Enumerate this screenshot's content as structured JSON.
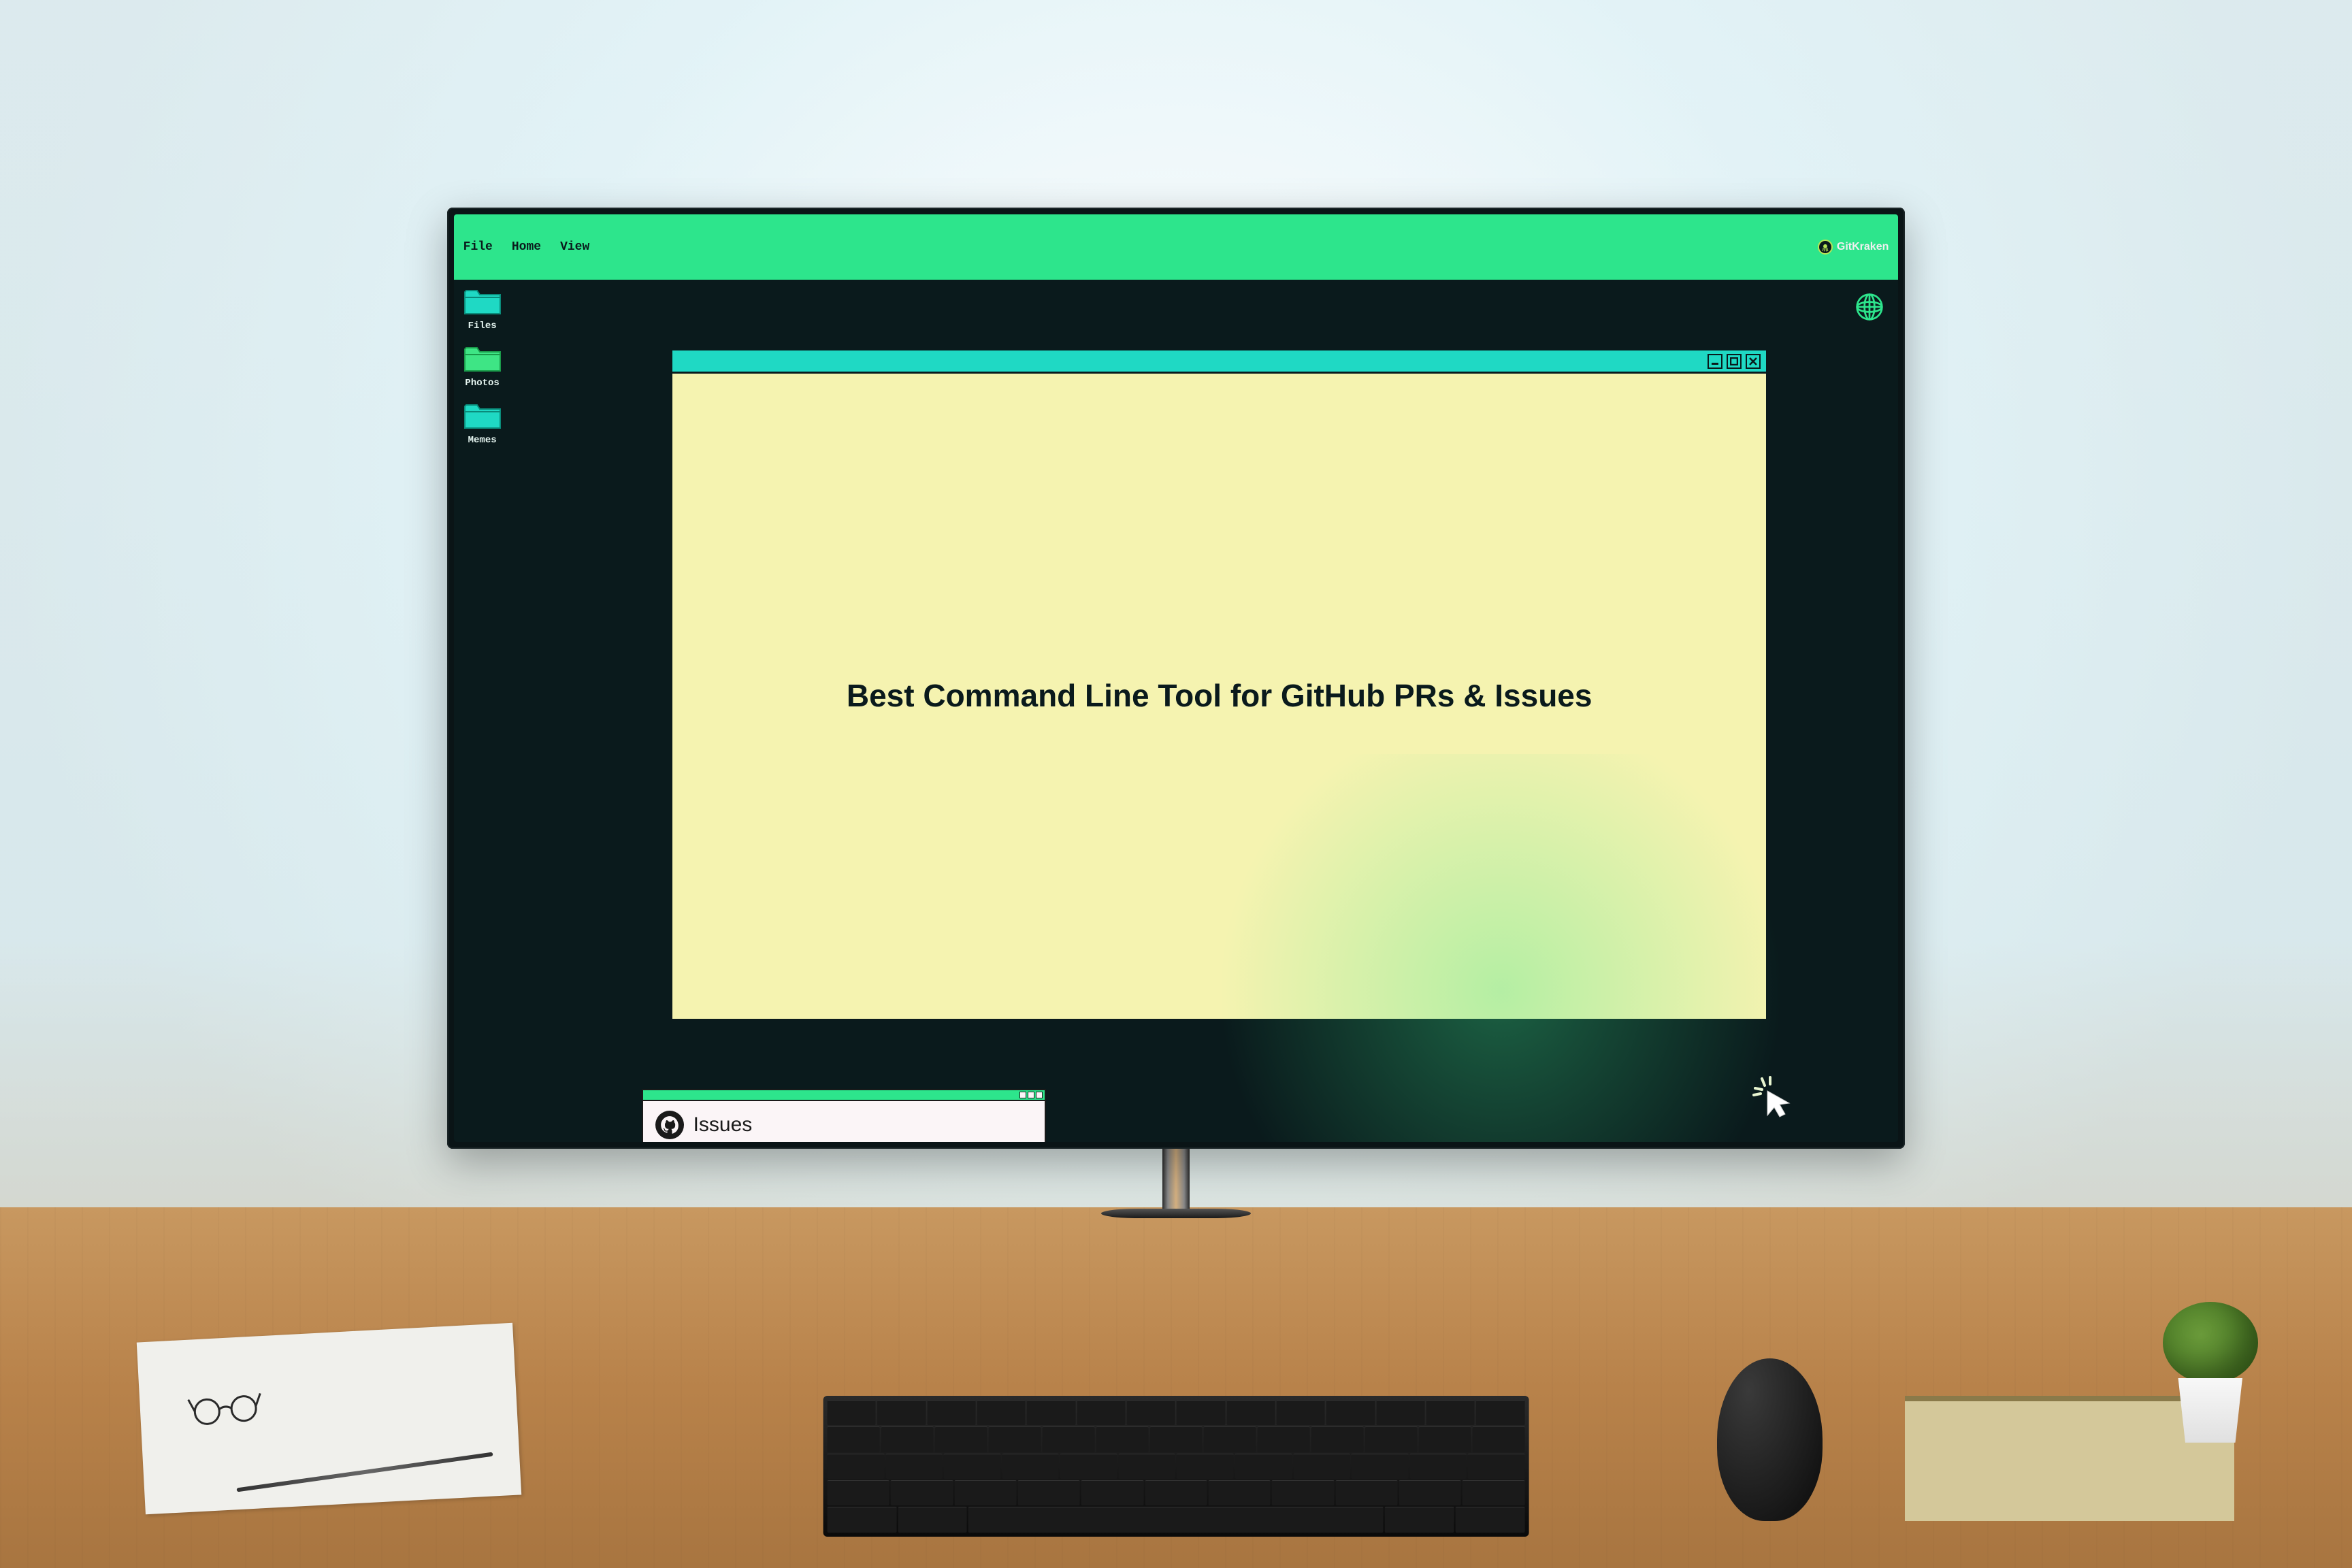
{
  "menubar": {
    "items": [
      "File",
      "Home",
      "View"
    ],
    "brand": "GitKraken"
  },
  "folders": [
    {
      "label": "Files",
      "color": "#1fd9c4"
    },
    {
      "label": "Photos",
      "color": "#3ee585"
    },
    {
      "label": "Memes",
      "color": "#1fd9c4"
    }
  ],
  "main_window": {
    "headline": "Best Command Line Tool for GitHub PRs & Issues"
  },
  "issues_window": {
    "label": "Issues"
  },
  "icons": {
    "globe": "globe-icon",
    "minimize": "minimize-icon",
    "maximize": "maximize-icon",
    "close": "close-icon",
    "cursor": "cursor-click-icon",
    "github": "github-icon",
    "kraken": "kraken-logo-icon"
  },
  "colors": {
    "menubar_bg": "#2de58c",
    "screen_bg": "#0a1a1c",
    "window_body": "#f5f3b0",
    "window_titlebar": "#1fd9c4",
    "accent_green": "#2de58c"
  }
}
